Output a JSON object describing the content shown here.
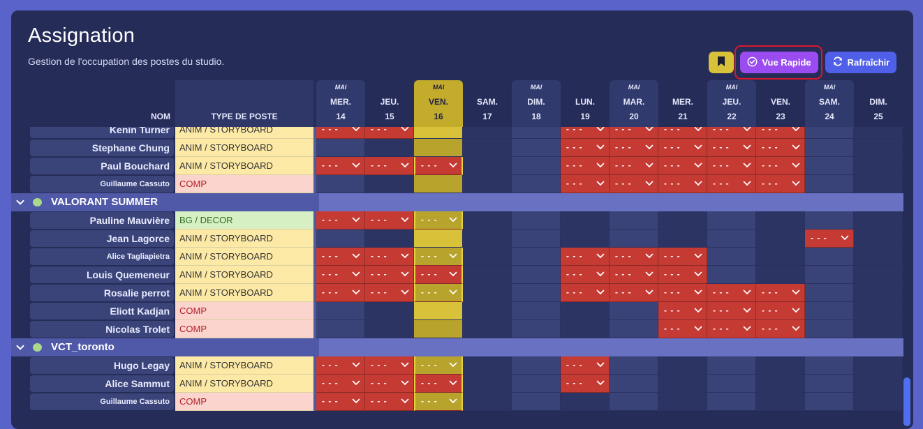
{
  "page": {
    "title": "Assignation",
    "subtitle": "Gestion de l'occupation des postes du studio."
  },
  "toolbar": {
    "bookmark_icon": "bookmark-icon",
    "vue_rapide_label": "Vue Rapide",
    "refresh_label": "Rafraîchir"
  },
  "columns": {
    "name": "NOM",
    "type": "TYPE DE POSTE"
  },
  "days": [
    {
      "month": "MAI",
      "weekday": "MER.",
      "day": "14"
    },
    {
      "month": "",
      "weekday": "JEU.",
      "day": "15"
    },
    {
      "month": "MAI",
      "weekday": "VEN.",
      "day": "16"
    },
    {
      "month": "",
      "weekday": "SAM.",
      "day": "17"
    },
    {
      "month": "MAI",
      "weekday": "DIM.",
      "day": "18"
    },
    {
      "month": "",
      "weekday": "LUN.",
      "day": "19"
    },
    {
      "month": "MAI",
      "weekday": "MAR.",
      "day": "20"
    },
    {
      "month": "",
      "weekday": "MER.",
      "day": "21"
    },
    {
      "month": "MAI",
      "weekday": "JEU.",
      "day": "22"
    },
    {
      "month": "",
      "weekday": "VEN.",
      "day": "23"
    },
    {
      "month": "MAI",
      "weekday": "SAM.",
      "day": "24"
    },
    {
      "month": "",
      "weekday": "DIM.",
      "day": "25"
    }
  ],
  "today_index": 2,
  "empty_slot": "- - -",
  "rows": [
    {
      "kind": "person",
      "name": "Kenin Turner",
      "type": "ANIM / STORYBOARD",
      "type_class": "anim",
      "cut": true,
      "slots": [
        0,
        1,
        5,
        6,
        7,
        8,
        9
      ]
    },
    {
      "kind": "person",
      "name": "Stephane Chung",
      "type": "ANIM / STORYBOARD",
      "type_class": "anim",
      "slots": [
        5,
        6,
        7,
        8,
        9
      ]
    },
    {
      "kind": "person",
      "name": "Paul Bouchard",
      "type": "ANIM / STORYBOARD",
      "type_class": "anim",
      "slots": [
        0,
        1,
        2,
        5,
        6,
        7,
        8,
        9
      ]
    },
    {
      "kind": "person",
      "name": "Guillaume Cassuto",
      "small": true,
      "type": "COMP",
      "type_class": "comp",
      "slots": [
        5,
        6,
        7,
        8,
        9
      ]
    },
    {
      "kind": "group",
      "name": "VALORANT SUMMER"
    },
    {
      "kind": "person",
      "name": "Pauline Mauvière",
      "type": "BG / DECOR",
      "type_class": "bg",
      "slots": [
        0,
        1,
        2
      ]
    },
    {
      "kind": "person",
      "name": "Jean Lagorce",
      "type": "ANIM / STORYBOARD",
      "type_class": "anim",
      "slots": [
        10
      ]
    },
    {
      "kind": "person",
      "name": "Alice Tagliapietra",
      "small": true,
      "type": "ANIM / STORYBOARD",
      "type_class": "anim",
      "slots": [
        0,
        1,
        2,
        5,
        6,
        7
      ]
    },
    {
      "kind": "person",
      "name": "Louis Quemeneur",
      "type": "ANIM / STORYBOARD",
      "type_class": "anim",
      "slots": [
        0,
        1,
        2,
        5,
        6,
        7
      ]
    },
    {
      "kind": "person",
      "name": "Rosalie perrot",
      "type": "ANIM / STORYBOARD",
      "type_class": "anim",
      "slots": [
        0,
        1,
        2,
        5,
        6,
        7,
        8,
        9
      ]
    },
    {
      "kind": "person",
      "name": "Eliott Kadjan",
      "type": "COMP",
      "type_class": "comp",
      "slots": [
        7,
        8,
        9
      ]
    },
    {
      "kind": "person",
      "name": "Nicolas Trolet",
      "type": "COMP",
      "type_class": "comp",
      "slots": [
        7,
        8,
        9
      ]
    },
    {
      "kind": "group",
      "name": "VCT_toronto"
    },
    {
      "kind": "person",
      "name": "Hugo Legay",
      "type": "ANIM / STORYBOARD",
      "type_class": "anim",
      "slots": [
        0,
        1,
        2,
        5
      ]
    },
    {
      "kind": "person",
      "name": "Alice Sammut",
      "type": "ANIM / STORYBOARD",
      "type_class": "anim",
      "slots": [
        0,
        1,
        2,
        5
      ]
    },
    {
      "kind": "person",
      "name": "Guillaume Cassuto",
      "small": true,
      "type": "COMP",
      "type_class": "comp",
      "slots": [
        0,
        1,
        2
      ]
    }
  ]
}
